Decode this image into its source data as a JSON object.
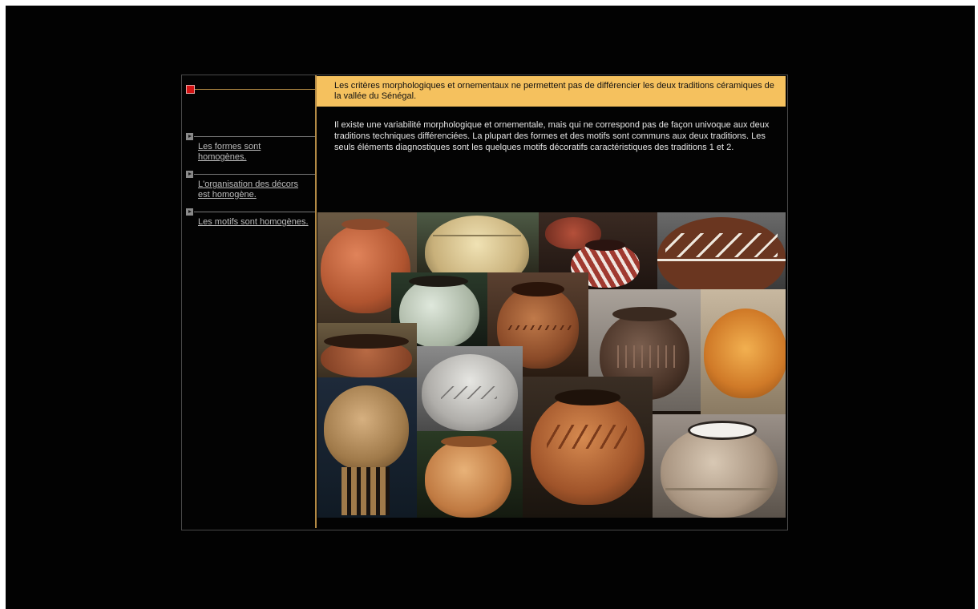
{
  "headline": "Les critères morphologiques et ornementaux ne permettent pas de différencier les deux traditions céramiques de la vallée du Sénégal.",
  "body_text": "Il existe une variabilité morphologique et ornementale, mais qui ne correspond pas de façon univoque aux deux traditions techniques différenciées. La plupart des formes et des motifs sont communs aux deux traditions. Les seuls éléments diagnostiques sont les quelques motifs décoratifs caractéristiques des traditions 1 et 2.",
  "nav": {
    "home_icon": "red-square-icon",
    "items": [
      {
        "label": "Les formes sont homogènes.",
        "icon": "arrow-right-icon"
      },
      {
        "label": "L'organisation des décors est homogène.",
        "icon": "arrow-right-icon"
      },
      {
        "label": "Les motifs sont homogènes.",
        "icon": "arrow-right-icon"
      }
    ]
  },
  "colors": {
    "headline_bg": "#f5c15e",
    "accent_line": "#b38a45",
    "background": "#020202",
    "link": "#bdbdbd"
  },
  "collage": {
    "description_icon": "pottery-collage-image",
    "tiles": 17
  }
}
